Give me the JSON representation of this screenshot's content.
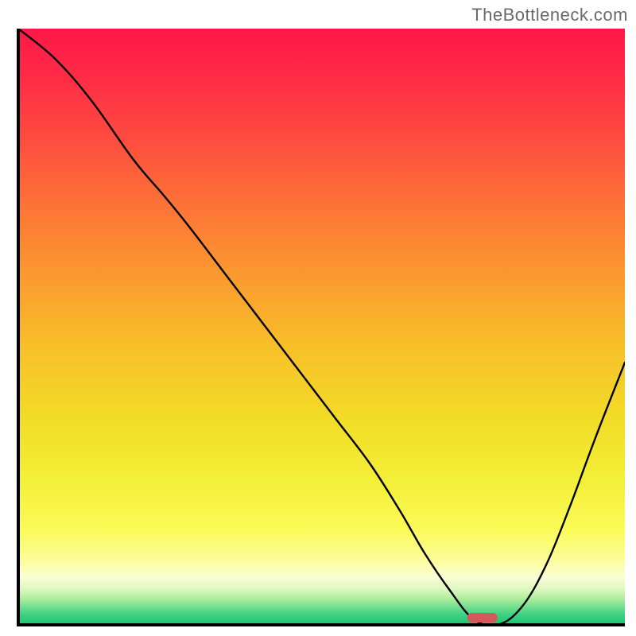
{
  "watermark": "TheBottleneck.com",
  "chart_data": {
    "type": "line",
    "title": "",
    "xlabel": "",
    "ylabel": "",
    "xlim": [
      0,
      100
    ],
    "ylim": [
      0,
      100
    ],
    "axes_visible": false,
    "border": {
      "left": true,
      "bottom": true,
      "right": false,
      "top": false
    },
    "background": {
      "kind": "vertical_gradient",
      "overall_stops": [
        {
          "pos": 0.0,
          "color": "#ff1748"
        },
        {
          "pos": 0.22,
          "color": "#fe543e"
        },
        {
          "pos": 0.5,
          "color": "#fab52b"
        },
        {
          "pos": 0.72,
          "color": "#f0e829"
        },
        {
          "pos": 0.86,
          "color": "#fdfc61"
        },
        {
          "pos": 0.92,
          "color": "#fcfed6"
        },
        {
          "pos": 0.955,
          "color": "#b7f09e"
        },
        {
          "pos": 0.975,
          "color": "#4ad486"
        },
        {
          "pos": 1.0,
          "color": "#19c670"
        }
      ]
    },
    "series": [
      {
        "name": "bottleneck_curve",
        "color": "#000000",
        "width": 2.4,
        "x": [
          0,
          6,
          12,
          19,
          24,
          28,
          34,
          40,
          46,
          52,
          58,
          63,
          67,
          71,
          75,
          79,
          83,
          87,
          91,
          95,
          100
        ],
        "y": [
          100,
          95,
          88,
          78,
          72,
          67,
          59,
          51,
          43,
          35,
          27,
          19,
          12,
          6,
          1,
          0,
          3,
          10,
          20,
          31,
          44
        ]
      }
    ],
    "marker": {
      "name": "optimal_point",
      "shape": "capsule",
      "color": "#d25a5d",
      "x": 76.5,
      "y": 1.2,
      "width": 5.0,
      "height": 1.6
    }
  }
}
